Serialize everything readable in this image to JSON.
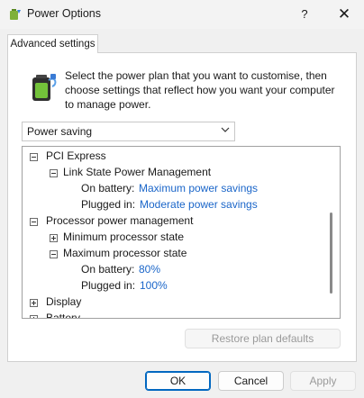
{
  "window": {
    "title": "Power Options",
    "help_label": "?",
    "close_label": "✕"
  },
  "tabs": [
    {
      "label": "Advanced settings"
    }
  ],
  "description": "Select the power plan that you want to customise, then choose settings that reflect how you want your computer to manage power.",
  "plan_select": {
    "value": "Power saving"
  },
  "tree": {
    "pci_express": "PCI Express",
    "link_state": "Link State Power Management",
    "link_on_battery_label": "On battery:",
    "link_on_battery_value": "Maximum power savings",
    "link_plugged_label": "Plugged in:",
    "link_plugged_value": "Moderate power savings",
    "processor": "Processor power management",
    "min_state": "Minimum processor state",
    "max_state": "Maximum processor state",
    "max_on_battery_label": "On battery:",
    "max_on_battery_value": "80%",
    "max_plugged_label": "Plugged in:",
    "max_plugged_value": "100%",
    "display": "Display",
    "battery": "Battery"
  },
  "buttons": {
    "restore": "Restore plan defaults",
    "ok": "OK",
    "cancel": "Cancel",
    "apply": "Apply"
  },
  "icons": {
    "app": "power-options-icon",
    "battery": "battery-icon",
    "chevron": "chevron-down-icon"
  }
}
